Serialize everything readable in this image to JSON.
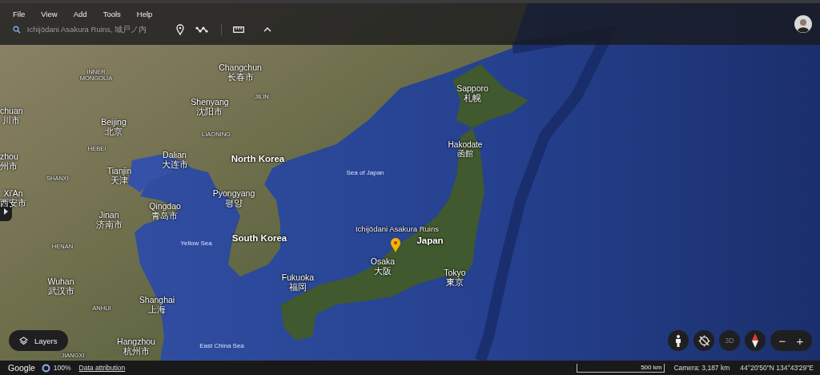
{
  "menu": [
    "File",
    "View",
    "Add",
    "Tools",
    "Help"
  ],
  "search": {
    "value": "Ichijōdani Asakura Ruins, 城戸ノ内"
  },
  "map_labels": [
    {
      "kind": "region",
      "lines": [
        "INNER",
        "MONGOLIA"
      ]
    },
    {
      "kind": "city",
      "lines": [
        "Changchun",
        "长春市"
      ]
    },
    {
      "kind": "city",
      "lines": [
        "Shenyang",
        "沈阳市"
      ]
    },
    {
      "kind": "region",
      "lines": [
        "JILIN"
      ]
    },
    {
      "kind": "region",
      "lines": [
        "LIAONING"
      ]
    },
    {
      "kind": "city",
      "lines": [
        "chuan",
        "川市"
      ]
    },
    {
      "kind": "city",
      "lines": [
        "Beijing",
        "北京"
      ]
    },
    {
      "kind": "region",
      "lines": [
        "HEBEI"
      ]
    },
    {
      "kind": "city",
      "lines": [
        "zhou",
        "州市"
      ]
    },
    {
      "kind": "city",
      "lines": [
        "Dalian",
        "大连市"
      ]
    },
    {
      "kind": "country",
      "lines": [
        "North Korea"
      ]
    },
    {
      "kind": "region",
      "lines": [
        "SHANXI"
      ]
    },
    {
      "kind": "city",
      "lines": [
        "Tianjin",
        "天津"
      ]
    },
    {
      "kind": "city",
      "lines": [
        "Xi'An",
        "西安市"
      ]
    },
    {
      "kind": "city",
      "lines": [
        "Pyongyang",
        "평양"
      ]
    },
    {
      "kind": "city",
      "lines": [
        "Qingdao",
        "青岛市"
      ]
    },
    {
      "kind": "city",
      "lines": [
        "Jinan",
        "济南市"
      ]
    },
    {
      "kind": "region",
      "lines": [
        "HENAN"
      ]
    },
    {
      "kind": "sea",
      "lines": [
        "Yellow Sea"
      ]
    },
    {
      "kind": "country",
      "lines": [
        "South Korea"
      ]
    },
    {
      "kind": "city",
      "lines": [
        "Wuhan",
        "武汉市"
      ]
    },
    {
      "kind": "region",
      "lines": [
        "ANHUI"
      ]
    },
    {
      "kind": "city",
      "lines": [
        "Shanghai",
        "上海"
      ]
    },
    {
      "kind": "city",
      "lines": [
        "Hangzhou",
        "杭州市"
      ]
    },
    {
      "kind": "sea",
      "lines": [
        "East China Sea"
      ]
    },
    {
      "kind": "region",
      "lines": [
        "JIANGXI"
      ]
    },
    {
      "kind": "city",
      "lines": [
        "Sapporo",
        "札幌"
      ]
    },
    {
      "kind": "town",
      "lines": [
        "Hakodate",
        "函館"
      ]
    },
    {
      "kind": "sea",
      "lines": [
        "Sea of Japan"
      ]
    },
    {
      "kind": "place",
      "lines": [
        "Ichijōdani Asakura Ruins"
      ]
    },
    {
      "kind": "country",
      "lines": [
        "Japan"
      ]
    },
    {
      "kind": "city",
      "lines": [
        "Fukuoka",
        "福岡"
      ]
    },
    {
      "kind": "city",
      "lines": [
        "Osaka",
        "大阪"
      ]
    },
    {
      "kind": "city",
      "lines": [
        "Tokyo",
        "東京"
      ]
    }
  ],
  "layers_button": {
    "label": "Layers"
  },
  "view_controls": {
    "three_d": "3D",
    "zoom_out": "−",
    "zoom_in": "+"
  },
  "status_bar": {
    "logo": "Google",
    "quality": "100%",
    "attribution": "Data attribution",
    "scale": "500 km",
    "camera": "Camera: 3,187 km",
    "coordinates": "44°20'50\"N 134°43'29\"E"
  }
}
